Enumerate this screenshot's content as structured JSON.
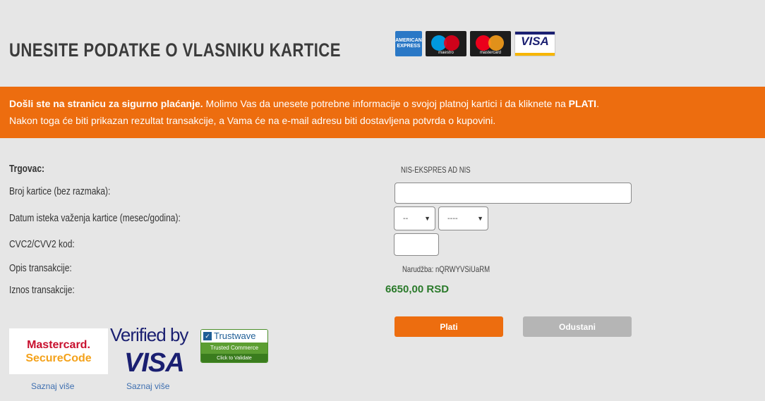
{
  "header": {
    "title": "UNESITE PODATKE O VLASNIKU KARTICE",
    "card_logos": [
      {
        "name": "american-express",
        "text": "AMERICAN EXPRESS"
      },
      {
        "name": "maestro",
        "text": "maestro"
      },
      {
        "name": "mastercard",
        "text": "mastercard"
      },
      {
        "name": "visa",
        "text": "VISA"
      }
    ]
  },
  "banner": {
    "bold_intro": "Došli ste na stranicu za sigurno plaćanje.",
    "line1_rest": " Molimo Vas da unesete potrebne informacije o svojoj platnoj kartici i da kliknete na ",
    "line1_action": "PLATI",
    "line1_end": ".",
    "line2": "Nakon toga će biti prikazan rezultat transakcije, a Vama će na e-mail adresu biti dostavljena potvrda o kupovini.",
    "color": "#ed6d0f"
  },
  "form": {
    "merchant_label": "Trgovac:",
    "merchant_value": "NIS-EKSPRES AD NIS",
    "card_number_label": "Broj kartice (bez razmaka):",
    "card_number_value": "",
    "expiry_label": "Datum isteka važenja kartice (mesec/godina):",
    "expiry_month": "--",
    "expiry_year": "----",
    "cvc_label": "CVC2/CVV2 kod:",
    "cvc_value": "",
    "description_label": "Opis transakcije:",
    "description_value": "Narudžba: nQRWYVSiUaRM",
    "amount_label": "Iznos transakcije:",
    "amount_value": "6650,00 RSD"
  },
  "buttons": {
    "pay": "Plati",
    "cancel": "Odustani"
  },
  "badges": {
    "securecode_line1": "Mastercard.",
    "securecode_line2": "SecureCode",
    "vbv_line1": "Verified by",
    "vbv_line2": "VISA",
    "trustwave_title": "Trustwave",
    "trustwave_sub": "Trusted Commerce",
    "trustwave_action": "Click to Validate",
    "learn_more_1": "Saznaj više",
    "learn_more_2": "Saznaj više"
  },
  "colors": {
    "accent": "#ed6d0f",
    "amount": "#2a7a2a",
    "background": "#e6e6e6"
  }
}
